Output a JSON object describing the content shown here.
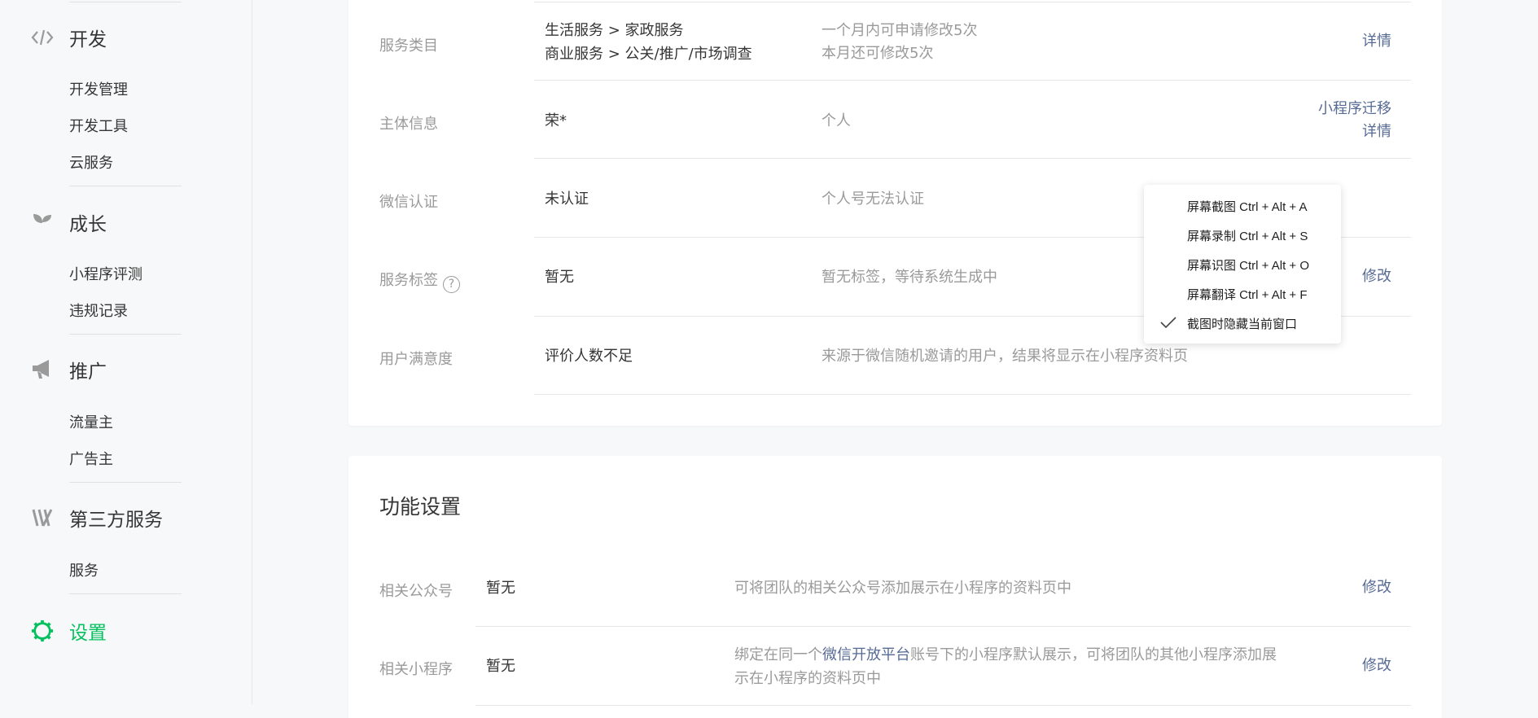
{
  "sidebar": {
    "groups": [
      {
        "label": "开发",
        "icon": "code-icon",
        "items": [
          "开发管理",
          "开发工具",
          "云服务"
        ]
      },
      {
        "label": "成长",
        "icon": "sprout-icon",
        "items": [
          "小程序评测",
          "违规记录"
        ]
      },
      {
        "label": "推广",
        "icon": "megaphone-icon",
        "items": [
          "流量主",
          "广告主"
        ]
      },
      {
        "label": "第三方服务",
        "icon": "third-party-icon",
        "items": [
          "服务"
        ]
      },
      {
        "label": "设置",
        "icon": "gear-icon",
        "items": []
      }
    ],
    "active_group": "设置",
    "active_color": "#07c160"
  },
  "basic_info": {
    "rows": [
      {
        "label": "服务类目",
        "value_lines": [
          "生活服务 > 家政服务",
          "商业服务 > 公关/推广/市场调查"
        ],
        "desc_lines": [
          "一个月内可申请修改5次",
          "本月还可修改5次"
        ],
        "actions": [
          "详情"
        ]
      },
      {
        "label": "主体信息",
        "value_lines": [
          "荣*"
        ],
        "desc_lines": [
          "个人"
        ],
        "actions": [
          "小程序迁移",
          "详情"
        ]
      },
      {
        "label": "微信认证",
        "value_lines": [
          "未认证"
        ],
        "desc_lines": [
          "个人号无法认证"
        ],
        "actions": []
      },
      {
        "label": "服务标签",
        "value_lines": [
          "暂无"
        ],
        "desc_lines": [
          "暂无标签，等待系统生成中"
        ],
        "actions": [
          "修改"
        ]
      },
      {
        "label": "用户满意度",
        "value_lines": [
          "评价人数不足"
        ],
        "desc_lines": [
          "来源于微信随机邀请的用户，结果将显示在小程序资料页"
        ],
        "actions": []
      }
    ]
  },
  "feature_settings": {
    "title": "功能设置",
    "rows": [
      {
        "label": "相关公众号",
        "value": "暂无",
        "desc": "可将团队的相关公众号添加展示在小程序的资料页中",
        "action": "修改"
      },
      {
        "label": "相关小程序",
        "value": "暂无",
        "desc_before_link": "绑定在同一个",
        "desc_link": "微信开放平台",
        "desc_after_link_line1": "账号下的小程序默认展示，可将团队的其他小程序添加展",
        "desc_line2": "示在小程序的资料页中",
        "action": "修改"
      }
    ]
  },
  "context_menu": {
    "items": [
      {
        "label": "屏幕截图 Ctrl + Alt + A",
        "checked": false
      },
      {
        "label": "屏幕录制 Ctrl + Alt + S",
        "checked": false
      },
      {
        "label": "屏幕识图 Ctrl + Alt + O",
        "checked": false
      },
      {
        "label": "屏幕翻译 Ctrl + Alt + F",
        "checked": false
      },
      {
        "label": "截图时隐藏当前窗口",
        "checked": true
      }
    ]
  },
  "colors": {
    "link": "#576b95",
    "muted": "#9a9a9a",
    "text": "#353535",
    "accent": "#07c160"
  }
}
